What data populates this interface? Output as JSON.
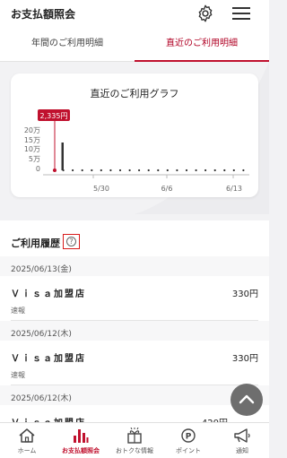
{
  "header": {
    "title": "お支払額照会"
  },
  "tabs": [
    {
      "label": "年間のご利用明細",
      "active": false
    },
    {
      "label": "直近のご利用明細",
      "active": true
    }
  ],
  "graph": {
    "title": "直近のご利用グラフ",
    "tooltip": "2,335円",
    "chart_data": {
      "type": "bar",
      "y_ticks": [
        "20万",
        "15万",
        "10万",
        "5万",
        "0"
      ],
      "x_ticks": [
        "5/30",
        "6/6",
        "6/13"
      ],
      "ylim": [
        0,
        200000
      ],
      "highlighted_value": 2335,
      "notable_bar_value": 120000
    }
  },
  "history": {
    "title": "ご利用履歴",
    "help_icon": "question-circle-icon",
    "entries": [
      {
        "date": "2025/06/13(金)",
        "merchant": "Ｖｉｓａ加盟店",
        "amount": "330円",
        "status": "速報"
      },
      {
        "date": "2025/06/12(木)",
        "merchant": "Ｖｉｓａ加盟店",
        "amount": "330円",
        "status": "速報"
      },
      {
        "date": "2025/06/12(木)",
        "merchant": "Ｖｉｓａ加盟店",
        "amount": "420円",
        "status": ""
      }
    ]
  },
  "bottom_nav": [
    {
      "label": "ホーム",
      "icon": "home-icon",
      "active": false
    },
    {
      "label": "お支払額照会",
      "icon": "bar-chart-icon",
      "active": true
    },
    {
      "label": "おトクな情報",
      "icon": "gift-icon",
      "active": false
    },
    {
      "label": "ポイント",
      "icon": "point-icon",
      "active": false
    },
    {
      "label": "通知",
      "icon": "megaphone-icon",
      "active": false
    }
  ],
  "colors": {
    "accent": "#c0112e",
    "text": "#222222"
  }
}
